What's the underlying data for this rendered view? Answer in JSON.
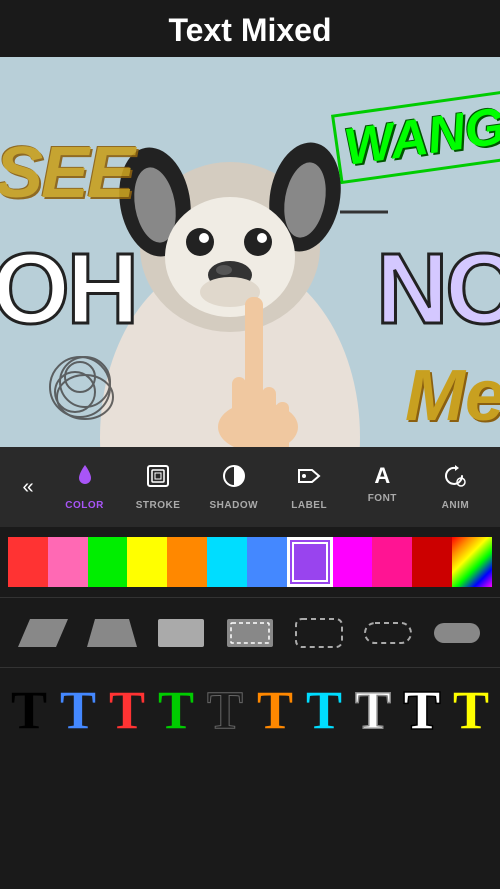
{
  "header": {
    "title": "Text Mixed"
  },
  "canvas": {
    "texts": {
      "see": "SEE",
      "wang": "WANG",
      "oh": "OH",
      "no": "NO",
      "me": "Me"
    }
  },
  "toolbar": {
    "back_icon": "«",
    "tools": [
      {
        "id": "color",
        "label": "COLOR",
        "icon": "💧",
        "active": true
      },
      {
        "id": "stroke",
        "label": "STROKE",
        "icon": "⊞",
        "active": false
      },
      {
        "id": "shadow",
        "label": "SHADOW",
        "icon": "◑",
        "active": false
      },
      {
        "id": "label",
        "label": "LABEL",
        "icon": "▷",
        "active": false
      },
      {
        "id": "font",
        "label": "FONT",
        "icon": "A",
        "active": false
      },
      {
        "id": "anim",
        "label": "ANIM",
        "icon": "↺",
        "active": false
      }
    ]
  },
  "colors": [
    {
      "id": "red",
      "color": "#ff3333",
      "selected": false
    },
    {
      "id": "pink",
      "color": "#ff69b4",
      "selected": false
    },
    {
      "id": "green",
      "color": "#00ff00",
      "selected": false
    },
    {
      "id": "yellow",
      "color": "#ffff00",
      "selected": false
    },
    {
      "id": "orange",
      "color": "#ff8800",
      "selected": false
    },
    {
      "id": "cyan",
      "color": "#00ffff",
      "selected": false
    },
    {
      "id": "blue-light",
      "color": "#4488ff",
      "selected": false
    },
    {
      "id": "purple",
      "color": "#9955ff",
      "selected": true
    },
    {
      "id": "magenta",
      "color": "#ff00ff",
      "selected": false
    },
    {
      "id": "hot-pink",
      "color": "#ff1493",
      "selected": false
    },
    {
      "id": "dark-red",
      "color": "#cc0000",
      "selected": false
    },
    {
      "id": "multi",
      "color": "multicolor",
      "selected": false
    }
  ],
  "shapes": [
    {
      "id": "parallelogram-left",
      "type": "parallelogram-left"
    },
    {
      "id": "trapezoid",
      "type": "trapezoid"
    },
    {
      "id": "rectangle",
      "type": "rectangle"
    },
    {
      "id": "dotted-rect",
      "type": "dotted-rect"
    },
    {
      "id": "rounded-dotted",
      "type": "rounded-dotted"
    },
    {
      "id": "pill-outline",
      "type": "pill-outline"
    },
    {
      "id": "pill-solid",
      "type": "pill-solid"
    }
  ],
  "text_styles": [
    {
      "id": "plain-black",
      "color": "#000000",
      "bg": "transparent"
    },
    {
      "id": "plain-blue",
      "color": "#4488ff",
      "bg": "transparent"
    },
    {
      "id": "plain-red",
      "color": "#ff3333",
      "bg": "transparent"
    },
    {
      "id": "plain-green",
      "color": "#00cc00",
      "bg": "transparent"
    },
    {
      "id": "plain-dark",
      "color": "#1a1a1a",
      "bg": "transparent"
    },
    {
      "id": "plain-orange",
      "color": "#ff8800",
      "bg": "transparent"
    },
    {
      "id": "plain-cyan",
      "color": "#00ffff",
      "bg": "transparent"
    },
    {
      "id": "outline-white",
      "color": "#ffffff",
      "bg": "transparent"
    },
    {
      "id": "outline-black",
      "color": "#000000",
      "bg": "transparent"
    },
    {
      "id": "yellow-t",
      "color": "#ffff00",
      "bg": "transparent"
    }
  ]
}
